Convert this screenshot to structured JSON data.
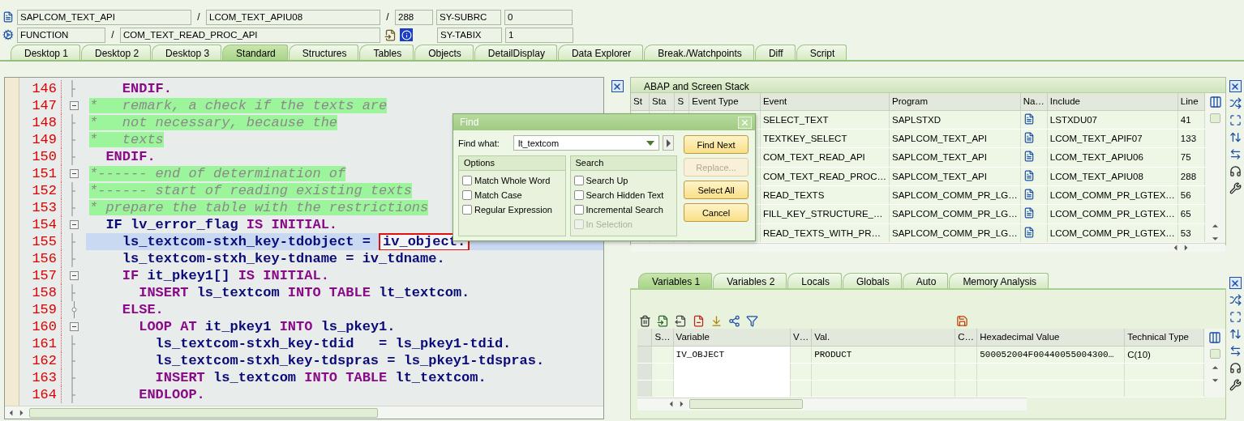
{
  "context": {
    "program": "SAPLCOM_TEXT_API",
    "program_separator": "/",
    "include": "LCOM_TEXT_APIU08",
    "include_separator": "/",
    "line": "288",
    "event_type": "FUNCTION",
    "event_separator": "/",
    "event": "COM_TEXT_READ_PROC_API",
    "system_fields": [
      {
        "name": "SY-SUBRC",
        "value": "0"
      },
      {
        "name": "SY-TABIX",
        "value": "1"
      }
    ]
  },
  "tabs": [
    {
      "label": "Desktop 1",
      "selected": false
    },
    {
      "label": "Desktop 2",
      "selected": false
    },
    {
      "label": "Desktop 3",
      "selected": false
    },
    {
      "label": "Standard",
      "selected": true
    },
    {
      "label": "Structures",
      "selected": false
    },
    {
      "label": "Tables",
      "selected": false
    },
    {
      "label": "Objects",
      "selected": false
    },
    {
      "label": "DetailDisplay",
      "selected": false
    },
    {
      "label": "Data Explorer",
      "selected": false
    },
    {
      "label": "Break./Watchpoints",
      "selected": false
    },
    {
      "label": "Diff",
      "selected": false
    },
    {
      "label": "Script",
      "selected": false
    }
  ],
  "code": {
    "lines": [
      {
        "number": "146",
        "kind": "line",
        "current": false,
        "segments": [
          {
            "text": "    ENDIF.",
            "kind": "keyword"
          }
        ]
      },
      {
        "number": "147",
        "kind": "box",
        "current": false,
        "segments": [
          {
            "text": "*   remark, a check if the texts are",
            "kind": "comment"
          }
        ]
      },
      {
        "number": "148",
        "kind": "line",
        "current": false,
        "segments": [
          {
            "text": "*   not necessary, because the",
            "kind": "comment"
          }
        ]
      },
      {
        "number": "149",
        "kind": "line",
        "current": false,
        "segments": [
          {
            "text": "*   texts",
            "kind": "comment"
          }
        ]
      },
      {
        "number": "150",
        "kind": "line",
        "current": false,
        "segments": [
          {
            "text": "  ENDIF.",
            "kind": "keyword"
          }
        ]
      },
      {
        "number": "151",
        "kind": "box",
        "current": false,
        "segments": [
          {
            "text": "*------ end of determination of",
            "kind": "comment"
          }
        ]
      },
      {
        "number": "152",
        "kind": "line",
        "current": false,
        "segments": [
          {
            "text": "*------ start of reading existing texts",
            "kind": "comment"
          }
        ]
      },
      {
        "number": "153",
        "kind": "line",
        "current": false,
        "segments": [
          {
            "text": "* prepare the table with the restrictions",
            "kind": "comment"
          }
        ]
      },
      {
        "number": "154",
        "kind": "box",
        "current": false,
        "segments": [
          {
            "text": "  IF lv_error_flag ",
            "kind": "ident"
          },
          {
            "text": "IS INITIAL.",
            "kind": "keyword"
          }
        ]
      },
      {
        "number": "155",
        "kind": "line",
        "current": true,
        "segments": [
          {
            "text": "    ls_textcom-stxh_key-tdobject = ",
            "kind": "ident"
          },
          {
            "text": "iv_object.",
            "kind": "match"
          }
        ]
      },
      {
        "number": "156",
        "kind": "line",
        "current": false,
        "segments": [
          {
            "text": "    ls_textcom-stxh_key-tdname = iv_tdname.",
            "kind": "ident"
          }
        ]
      },
      {
        "number": "157",
        "kind": "box",
        "current": false,
        "segments": [
          {
            "text": "    IF ",
            "kind": "keyword"
          },
          {
            "text": "it_pkey1[] ",
            "kind": "ident"
          },
          {
            "text": "IS INITIAL.",
            "kind": "keyword"
          }
        ]
      },
      {
        "number": "158",
        "kind": "line",
        "current": false,
        "segments": [
          {
            "text": "      INSERT ",
            "kind": "keyword"
          },
          {
            "text": "ls_textcom ",
            "kind": "ident"
          },
          {
            "text": "INTO TABLE ",
            "kind": "keyword"
          },
          {
            "text": "lt_textcom.",
            "kind": "ident"
          }
        ]
      },
      {
        "number": "159",
        "kind": "dot",
        "current": false,
        "segments": [
          {
            "text": "    ELSE.",
            "kind": "keyword"
          }
        ]
      },
      {
        "number": "160",
        "kind": "box",
        "current": false,
        "segments": [
          {
            "text": "      LOOP AT ",
            "kind": "keyword"
          },
          {
            "text": "it_pkey1 ",
            "kind": "ident"
          },
          {
            "text": "INTO ",
            "kind": "keyword"
          },
          {
            "text": "ls_pkey1.",
            "kind": "ident"
          }
        ]
      },
      {
        "number": "161",
        "kind": "line",
        "current": false,
        "segments": [
          {
            "text": "        ls_textcom-stxh_key-tdid   = ls_pkey1-tdid.",
            "kind": "ident"
          }
        ]
      },
      {
        "number": "162",
        "kind": "line",
        "current": false,
        "segments": [
          {
            "text": "        ls_textcom-stxh_key-tdspras = ls_pkey1-tdspras.",
            "kind": "ident"
          }
        ]
      },
      {
        "number": "163",
        "kind": "line",
        "current": false,
        "segments": [
          {
            "text": "        INSERT ",
            "kind": "keyword"
          },
          {
            "text": "ls_textcom ",
            "kind": "ident"
          },
          {
            "text": "INTO TABLE ",
            "kind": "keyword"
          },
          {
            "text": "lt_textcom.",
            "kind": "ident"
          }
        ]
      },
      {
        "number": "164",
        "kind": "line",
        "current": false,
        "segments": [
          {
            "text": "      ENDLOOP.",
            "kind": "keyword"
          }
        ]
      }
    ]
  },
  "find_dialog": {
    "title": "Find",
    "find_what_label": "Find what:",
    "find_what": "lt_textcom",
    "groups": [
      {
        "title": "Options",
        "items": [
          {
            "label": "Match Whole Word",
            "checked": false,
            "disabled": false
          },
          {
            "label": "Match Case",
            "checked": false,
            "disabled": false
          },
          {
            "label": "Regular Expression",
            "checked": false,
            "disabled": false
          }
        ]
      },
      {
        "title": "Search",
        "items": [
          {
            "label": "Search Up",
            "checked": false,
            "disabled": false
          },
          {
            "label": "Search Hidden Text",
            "checked": false,
            "disabled": false
          },
          {
            "label": "Incremental Search",
            "checked": false,
            "disabled": false
          },
          {
            "label": "In Selection",
            "checked": false,
            "disabled": true
          }
        ]
      }
    ],
    "buttons": [
      {
        "label": "Find Next",
        "disabled": false
      },
      {
        "label": "Replace...",
        "disabled": true
      },
      {
        "label": "Select All",
        "disabled": false
      },
      {
        "label": "Cancel",
        "disabled": false
      }
    ]
  },
  "stack": {
    "title": "ABAP and Screen Stack",
    "columns": [
      "St",
      "Sta",
      "S",
      "Event Type",
      "Event",
      "Program",
      "Na…",
      "Include",
      "Line"
    ],
    "rows": [
      {
        "event": "SELECT_TEXT",
        "program": "SAPLSTXD",
        "include": "LSTXDU07",
        "line": "41"
      },
      {
        "event": "TEXTKEY_SELECT",
        "program": "SAPLCOM_TEXT_API",
        "include": "LCOM_TEXT_APIF07",
        "line": "133"
      },
      {
        "event": "COM_TEXT_READ_API",
        "program": "SAPLCOM_TEXT_API",
        "include": "LCOM_TEXT_APIU06",
        "line": "75"
      },
      {
        "event": "COM_TEXT_READ_PROC…",
        "program": "SAPLCOM_TEXT_API",
        "include": "LCOM_TEXT_APIU08",
        "line": "288"
      },
      {
        "event": "READ_TEXTS",
        "program": "SAPLCOM_COMM_PR_LG…",
        "include": "LCOM_COMM_PR_LGTEX…",
        "line": "56"
      },
      {
        "event": "FILL_KEY_STRUCTURE_…",
        "program": "SAPLCOM_COMM_PR_LG…",
        "include": "LCOM_COMM_PR_LGTEX…",
        "line": "65"
      },
      {
        "event": "READ_TEXTS_WITH_PR…",
        "program": "SAPLCOM_COMM_PR_LG…",
        "include": "LCOM_COMM_PR_LGTEX…",
        "line": "53"
      }
    ]
  },
  "variables": {
    "tabs": [
      {
        "label": "Variables 1",
        "selected": true
      },
      {
        "label": "Variables 2",
        "selected": false
      },
      {
        "label": "Locals",
        "selected": false
      },
      {
        "label": "Globals",
        "selected": false
      },
      {
        "label": "Auto",
        "selected": false
      },
      {
        "label": "Memory Analysis",
        "selected": false
      }
    ],
    "columns": [
      "S…",
      "Variable",
      "V…",
      "Val.",
      "C…",
      "Hexadecimal Value",
      "Technical Type"
    ],
    "rows": [
      {
        "variable": "IV_OBJECT",
        "value": "PRODUCT",
        "hex": "500052004F00440055004300…",
        "technical_type": "C(10)"
      }
    ]
  }
}
